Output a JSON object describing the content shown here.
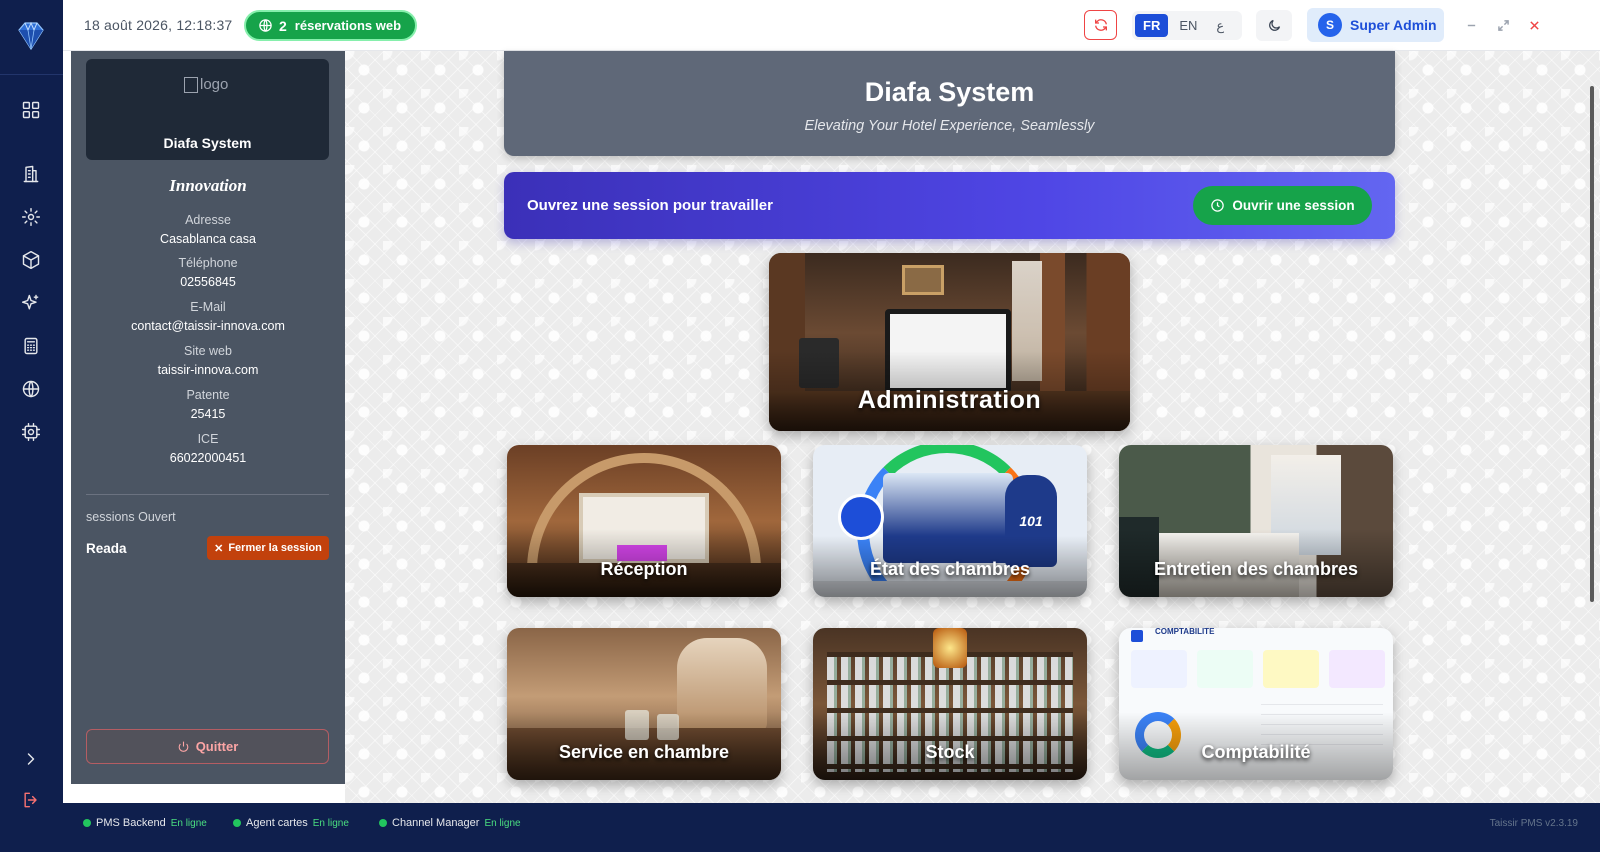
{
  "topbar": {
    "datetime": "18 août 2026, 12:18:37",
    "web_reservations_count": "2",
    "web_reservations_label": "réservations web",
    "languages": [
      "FR",
      "EN",
      "ع"
    ],
    "active_language": "FR",
    "user_initial": "S",
    "user_name": "Super Admin"
  },
  "info_panel": {
    "logo_alt": "logo",
    "brand_name": "Diafa System",
    "company_name": "Innovation",
    "fields": [
      {
        "label": "Adresse",
        "value": "Casablanca casa"
      },
      {
        "label": "Téléphone",
        "value": "02556845"
      },
      {
        "label": "E-Mail",
        "value": "contact@taissir-innova.com"
      },
      {
        "label": "Site web",
        "value": "taissir-innova.com"
      },
      {
        "label": "Patente",
        "value": "25415"
      },
      {
        "label": "ICE",
        "value": "66022000451"
      }
    ],
    "sessions_title": "sessions Ouvert",
    "session_user": "Reada",
    "close_session_label": "Fermer la session",
    "quit_label": "Quitter"
  },
  "main": {
    "hero_title": "Diafa System",
    "hero_subtitle": "Elevating Your Hotel Experience, Seamlessly",
    "banner_text": "Ouvrez une session pour travailler",
    "open_session_label": "Ouvrir une session",
    "modules": {
      "administration": "Administration",
      "reception": "Réception",
      "room_status": "État des chambres",
      "housekeeping": "Entretien des chambres",
      "room_service": "Service en chambre",
      "stock": "Stock",
      "accounting": "Comptabilité"
    },
    "room_status_tag": "101",
    "accounting_header": "COMPTABILITÉ"
  },
  "footer": {
    "services": [
      {
        "name": "PMS Backend",
        "state": "En ligne"
      },
      {
        "name": "Agent cartes",
        "state": "En ligne"
      },
      {
        "name": "Channel Manager",
        "state": "En ligne"
      }
    ],
    "version": "Taissir PMS v2.3.19"
  },
  "colors": {
    "rail": "#0f1f4d",
    "panel": "#4b5563",
    "accent_green": "#16a34a",
    "accent_indigo": "#4f46e5",
    "danger": "#ef4444"
  },
  "icons": [
    "diamond-logo-icon",
    "grid-icon",
    "building-icon",
    "gear-icon",
    "box-icon",
    "sparkles-icon",
    "calculator-icon",
    "globe-icon",
    "chip-settings-icon",
    "chevron-right-icon",
    "logout-icon",
    "refresh-icon",
    "moon-icon",
    "clock-icon",
    "power-icon"
  ]
}
